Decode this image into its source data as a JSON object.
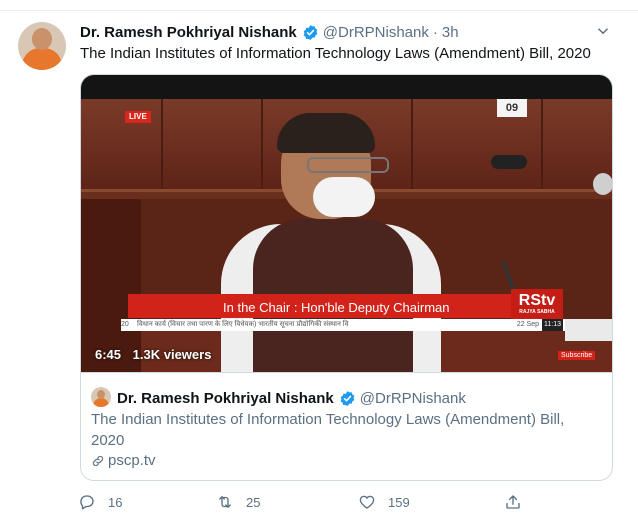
{
  "tweet": {
    "author_name": "Dr. Ramesh Pokhriyal Nishank",
    "handle": "@DrRPNishank",
    "separator": "·",
    "time": "3h",
    "text": "The Indian Institutes of Information Technology Laws (Amendment) Bill, 2020"
  },
  "video": {
    "live_badge": "LIVE",
    "seat_number": "09",
    "lower_third": "In the Chair :  Hon'ble Deputy Chairman",
    "channel_logo": "RStv",
    "channel_sub": "RAJYA SABHA",
    "ticker_number": "20",
    "ticker_text": "विधान कार्य (विचार तथा पारण के लिए विधेयक)  भारतीय सूचना प्रौद्योगिकी संस्थान वि",
    "ticker_date": "22 Sep",
    "ticker_time": "11:13",
    "subscribe_label": "Subscribe",
    "duration": "6:45",
    "viewers": "1.3K viewers"
  },
  "card": {
    "author_name": "Dr. Ramesh Pokhriyal Nishank",
    "handle": "@DrRPNishank",
    "title": "The Indian Institutes of Information Technology Laws (Amendment) Bill, 2020",
    "link": "pscp.tv"
  },
  "actions": {
    "replies": "16",
    "retweets": "25",
    "likes": "159"
  },
  "colors": {
    "verified": "#1d9bf0",
    "secondary_text": "#5b7083",
    "border": "#cfd9de",
    "rstv_red": "#d2231a"
  },
  "icons": [
    "verified-badge-icon",
    "chevron-down-icon",
    "link-icon",
    "reply-icon",
    "retweet-icon",
    "like-icon",
    "share-icon"
  ]
}
